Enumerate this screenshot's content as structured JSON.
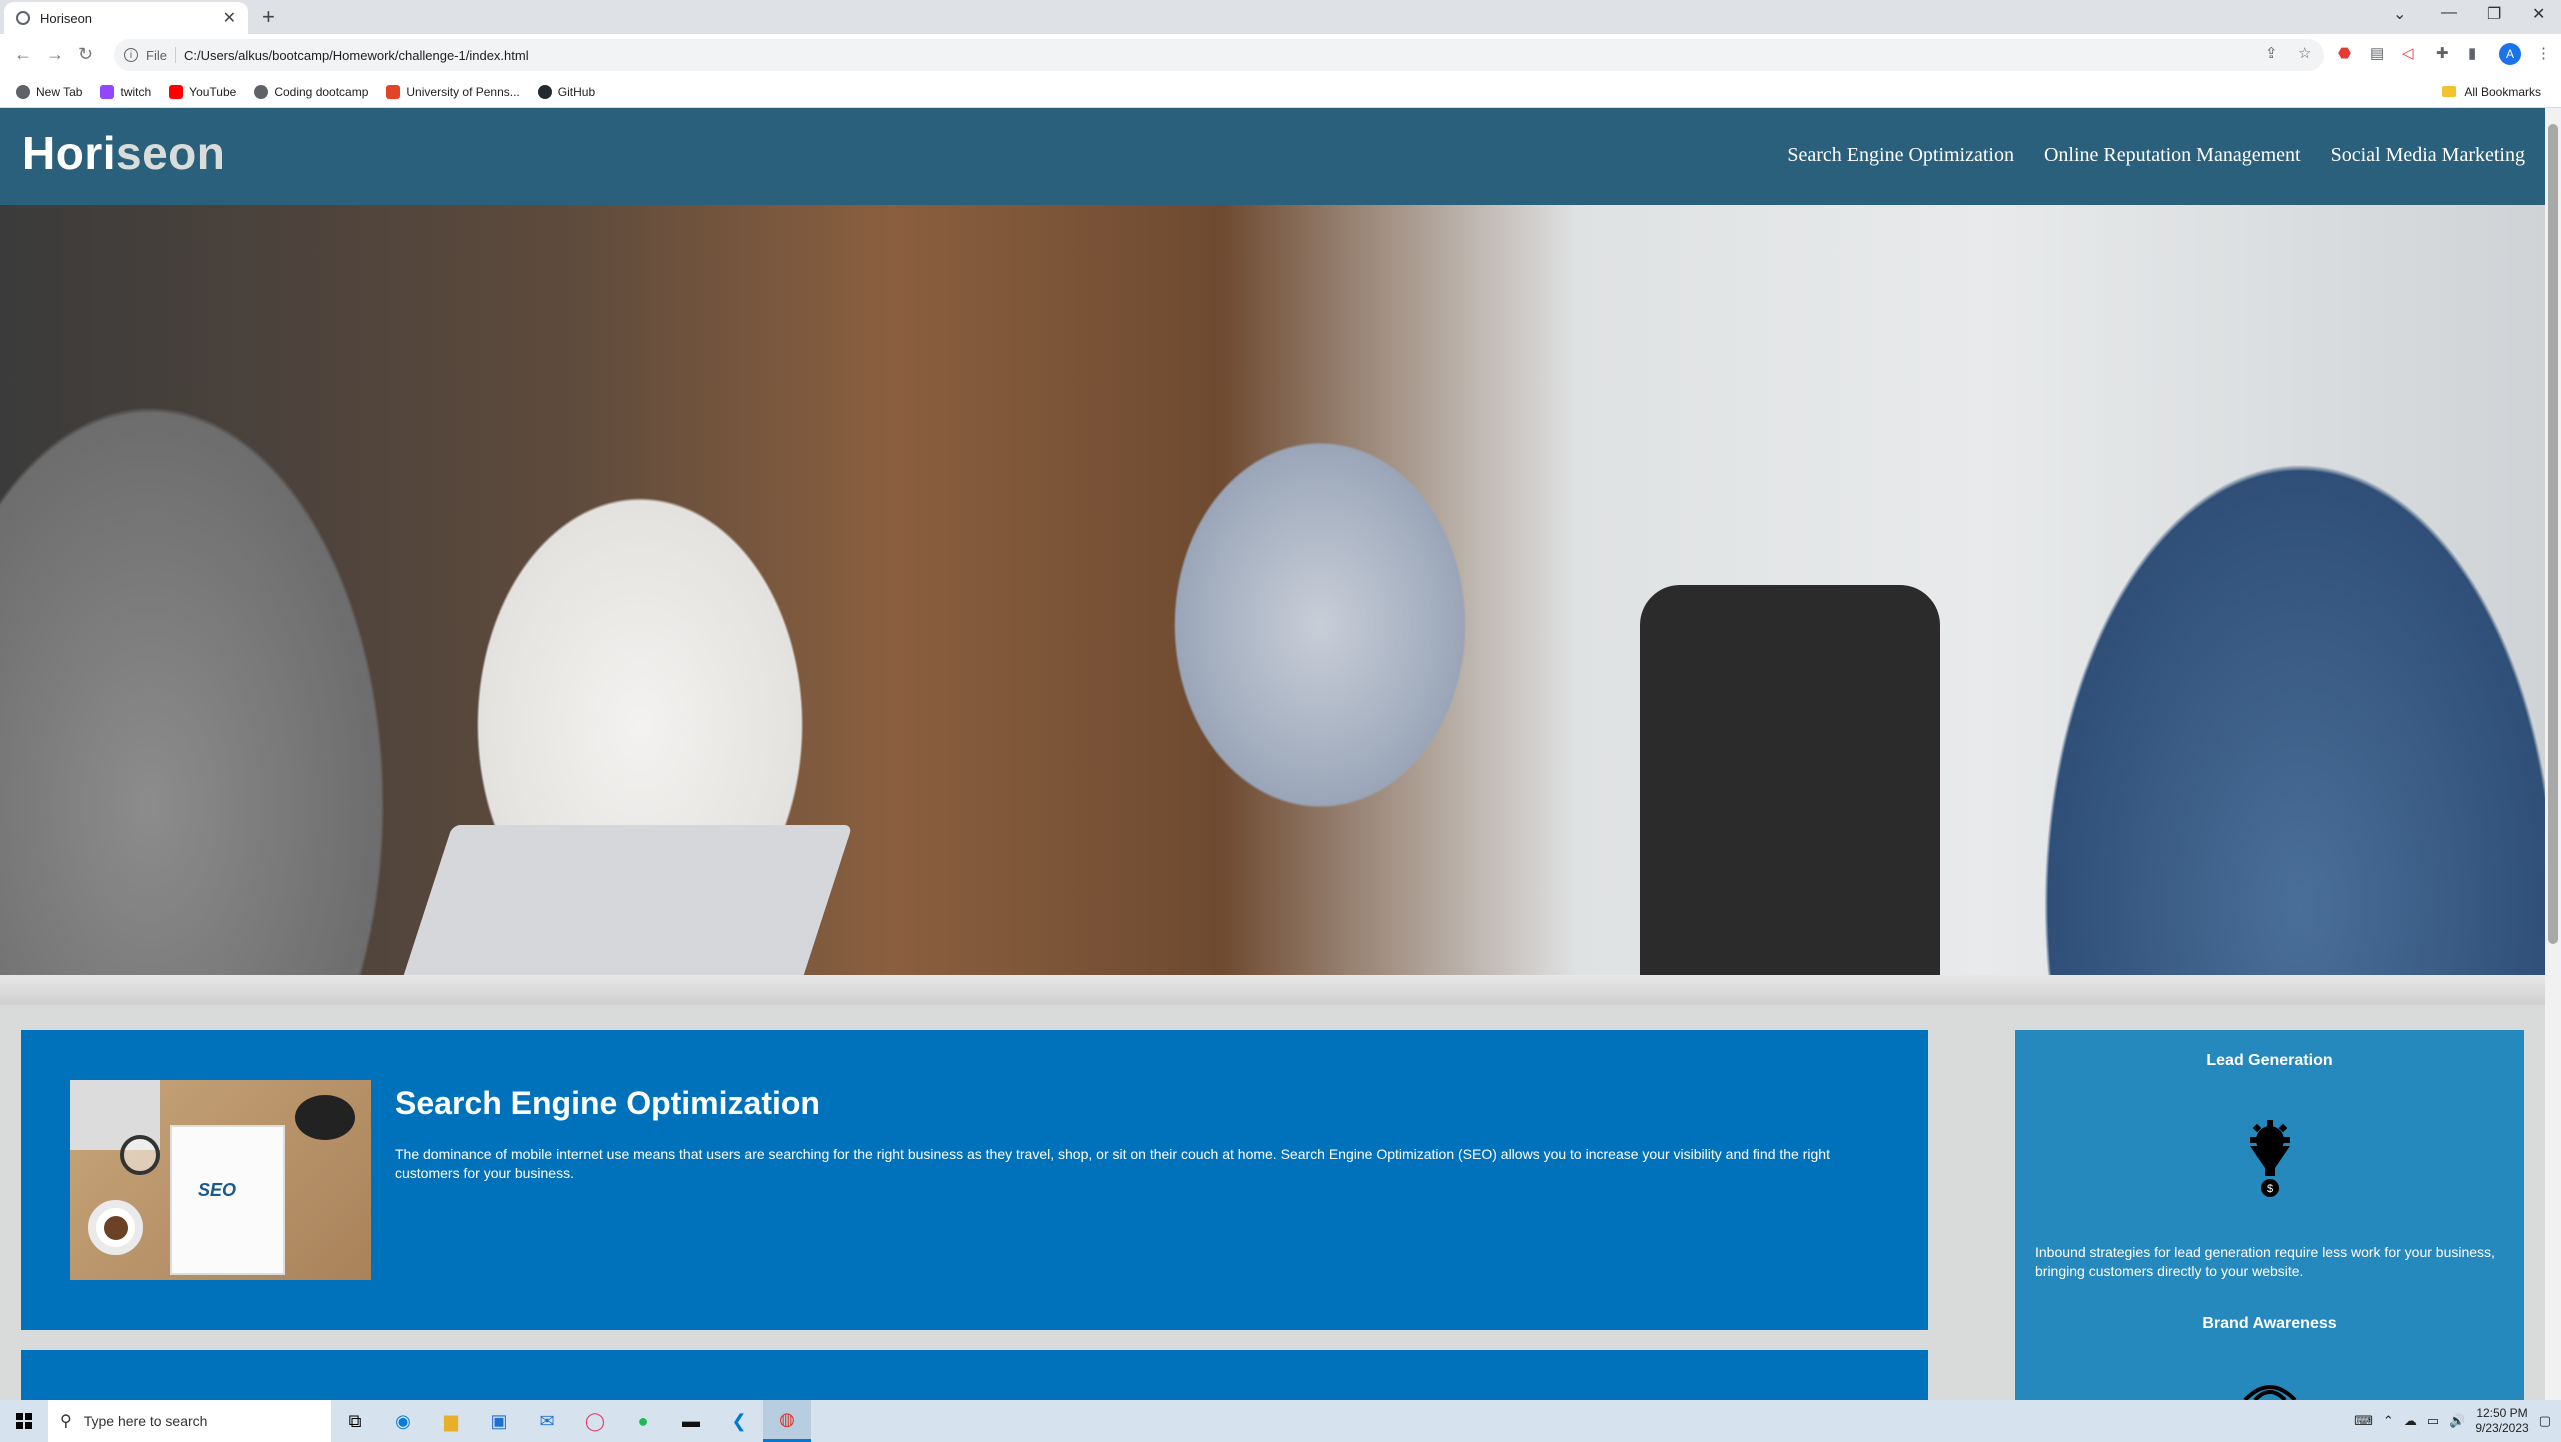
{
  "browser": {
    "tab_title": "Horiseon",
    "url_scheme_label": "File",
    "url": "C:/Users/alkus/bootcamp/Homework/challenge-1/index.html",
    "bookmarks": [
      {
        "label": "New Tab",
        "color": "#5f6368"
      },
      {
        "label": "twitch",
        "color": "#9146ff"
      },
      {
        "label": "YouTube",
        "color": "#ff0000"
      },
      {
        "label": "Coding dootcamp",
        "color": "#5f6368"
      },
      {
        "label": "University of Penns...",
        "color": "#e24329"
      },
      {
        "label": "GitHub",
        "color": "#24292f"
      }
    ],
    "all_bookmarks": "All Bookmarks",
    "profile_initial": "A"
  },
  "site": {
    "logo_main": "Hori",
    "logo_accent": "seon",
    "nav": [
      "Search Engine Optimization",
      "Online Reputation Management",
      "Social Media Marketing"
    ],
    "colors": {
      "header": "#2a607c",
      "content_box": "#0072bb",
      "sidebar": "#2589bd",
      "page_bg": "#d9dbdb"
    }
  },
  "content": {
    "seo_title": "Search Engine Optimization",
    "seo_text": "The dominance of mobile internet use means that users are searching for the right business as they travel, shop, or sit on their couch at home. Search Engine Optimization (SEO) allows you to increase your visibility and find the right customers for your business.",
    "seo_image_word": "SEO"
  },
  "sidebar": {
    "lead_title": "Lead Generation",
    "lead_text": "Inbound strategies for lead generation require less work for your business, bringing customers directly to your website.",
    "brand_title": "Brand Awareness"
  },
  "taskbar": {
    "search_placeholder": "Type here to search",
    "time": "12:50 PM",
    "date": "9/23/2023",
    "apps": [
      "task-view-icon",
      "edge-icon",
      "file-explorer-icon",
      "store-icon",
      "mail-icon",
      "opera-icon",
      "spotify-icon",
      "terminal-icon",
      "vscode-icon",
      "chrome-icon"
    ]
  }
}
